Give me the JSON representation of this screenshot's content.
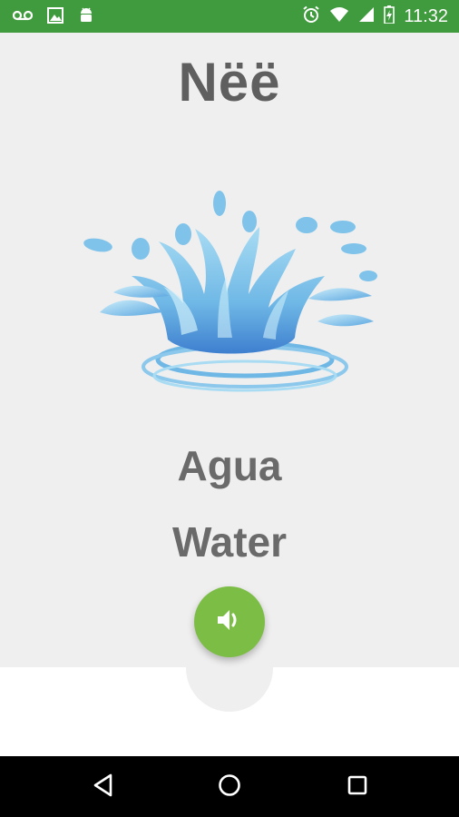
{
  "status_bar": {
    "time": "11:32",
    "background": "#3f9b3d",
    "left_icons": [
      "voicemail-icon",
      "image-icon",
      "android-icon"
    ],
    "right_icons": [
      "alarm-icon",
      "wifi-icon",
      "signal-icon",
      "battery-icon"
    ]
  },
  "app": {
    "title": "Nëë",
    "image": "water-splash",
    "word_native": "Agua",
    "word_english": "Water",
    "audio_button_icon": "speaker-icon",
    "accent": "#7cbd45"
  },
  "nav_bar": {
    "buttons": [
      "back-icon",
      "home-icon",
      "recents-icon"
    ]
  }
}
